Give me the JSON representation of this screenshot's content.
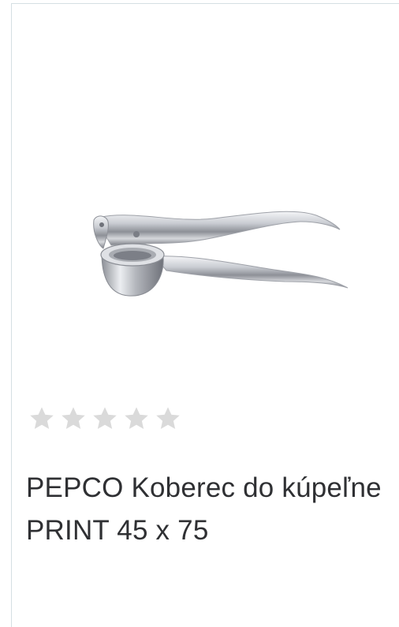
{
  "product": {
    "title": "PEPCO Koberec do kúpeľne PRINT 45 x 75",
    "image_icon": "garlic-press-image",
    "rating": {
      "value": 0,
      "max": 5,
      "star_color_empty": "#dadada"
    }
  },
  "colors": {
    "border": "#d5dfe3",
    "title_text": "#2f3033",
    "background": "#ffffff"
  }
}
